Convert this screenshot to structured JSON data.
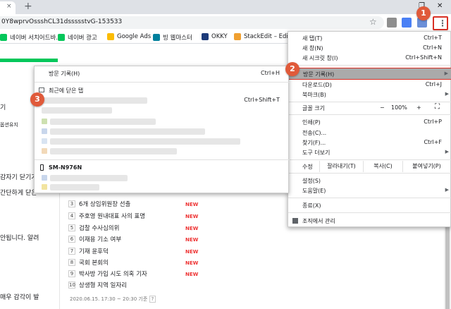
{
  "browser": {
    "tab_close": "×",
    "new_tab": "+",
    "window_restore": "❐",
    "window_close": "✕",
    "url": "0Y8wprvOssshCL31dssssstvG-153533",
    "star": "☆",
    "menu_icon": "⋮"
  },
  "bookmarks": [
    {
      "label": "네이버 서치어드바...",
      "color": "#03c75a"
    },
    {
      "label": "네이버 광고",
      "color": "#03c75a"
    },
    {
      "label": "Google Ads",
      "color": "#fbbc04"
    },
    {
      "label": "빙 웹마스터",
      "color": "#00809d"
    },
    {
      "label": "OKKY",
      "color": "#1d3b7a"
    },
    {
      "label": "StackEdit – Editor",
      "color": "#f0a030"
    }
  ],
  "page": {
    "left_snippets": [
      "기",
      "옵션유지",
      "감자기 닫기가",
      "간단하게 닫은",
      "안됩니다. 알려",
      "매우 감각이 발"
    ],
    "ranking": [
      {
        "num": "3",
        "text": "6개 상임위원장 선출",
        "badge": "NEW"
      },
      {
        "num": "4",
        "text": "주호영 원내대표 사의 표명",
        "badge": "NEW"
      },
      {
        "num": "5",
        "text": "검찰 수사심의위",
        "badge": "NEW"
      },
      {
        "num": "6",
        "text": "이재용 기소 여부",
        "badge": "NEW"
      },
      {
        "num": "7",
        "text": "기재 윤후덕",
        "badge": "NEW"
      },
      {
        "num": "8",
        "text": "국회 본회의",
        "badge": "NEW"
      },
      {
        "num": "9",
        "text": "박사방 가입 시도 의혹 기자",
        "badge": "NEW"
      },
      {
        "num": "10",
        "text": "상생형 지역 일자리",
        "badge": ""
      }
    ],
    "footnote": "2020.06.15. 17:30 ~ 20:30 기준",
    "footnote_help": "?"
  },
  "main_menu": {
    "new_tab": {
      "label": "새 탭(T)",
      "shortcut": "Ctrl+T"
    },
    "new_window": {
      "label": "새 창(N)",
      "shortcut": "Ctrl+N"
    },
    "incognito": {
      "label": "새 시크릿 창(I)",
      "shortcut": "Ctrl+Shift+N"
    },
    "history": {
      "label": "방문 기록(H)",
      "arrow": "▶"
    },
    "downloads": {
      "label": "다운로드(D)",
      "shortcut": "Ctrl+J"
    },
    "bookmarks": {
      "label": "북마크(B)",
      "arrow": "▶"
    },
    "zoom": {
      "label": "글꼴 크기",
      "minus": "−",
      "value": "100%",
      "plus": "+",
      "fullscreen": "⛶"
    },
    "print": {
      "label": "인쇄(P)",
      "shortcut": "Ctrl+P"
    },
    "cast": {
      "label": "전송(C)..."
    },
    "find": {
      "label": "찾기(F)...",
      "shortcut": "Ctrl+F"
    },
    "more_tools": {
      "label": "도구 더보기",
      "arrow": "▶"
    },
    "edit": {
      "label": "수정",
      "cut": "잘라내기(T)",
      "copy": "복사(C)",
      "paste": "붙여넣기(P)"
    },
    "settings": {
      "label": "설정(S)"
    },
    "help": {
      "label": "도움말(E)",
      "arrow": "▶"
    },
    "exit": {
      "label": "종료(X)"
    },
    "managed": {
      "label": "조직에서 관리"
    }
  },
  "history_menu": {
    "history": {
      "label": "방문 기록(H)",
      "shortcut": "Ctrl+H"
    },
    "recently_closed": {
      "label": "최근에 닫은 탭"
    },
    "reopen_shortcut": "Ctrl+Shift+T",
    "device": {
      "label": "SM-N976N"
    }
  },
  "badges": [
    "1",
    "2",
    "3"
  ]
}
